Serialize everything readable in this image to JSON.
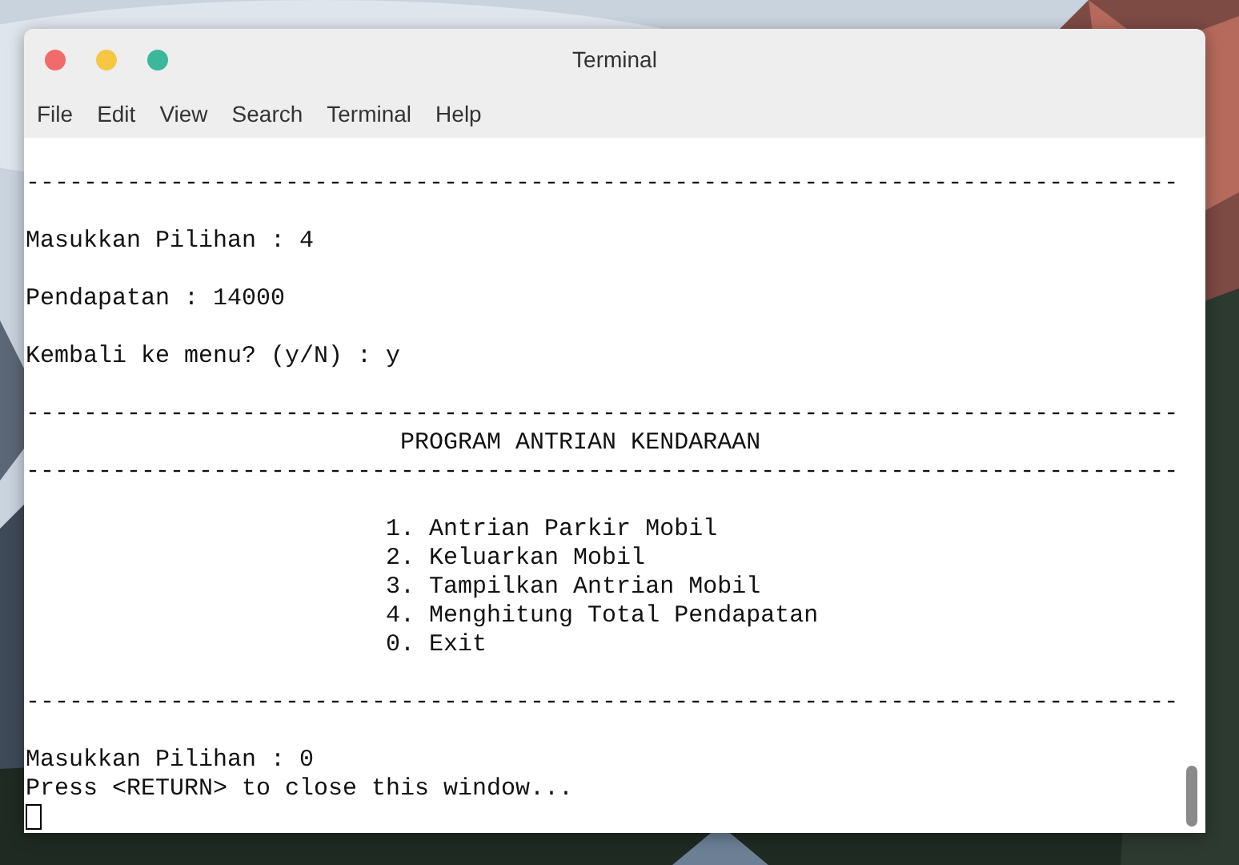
{
  "window": {
    "title": "Terminal",
    "controls": [
      {
        "color": "#f26b6b"
      },
      {
        "color": "#f7c744"
      },
      {
        "color": "#3bb89a"
      }
    ]
  },
  "menu": [
    "File",
    "Edit",
    "View",
    "Search",
    "Terminal",
    "Help"
  ],
  "terminal": {
    "lines": [
      {
        "kind": "blank"
      },
      {
        "kind": "text",
        "text": "--------------------------------------------------------------------------------"
      },
      {
        "kind": "blank"
      },
      {
        "kind": "text",
        "text": "Masukkan Pilihan : 4"
      },
      {
        "kind": "blank"
      },
      {
        "kind": "text",
        "text": "Pendapatan : 14000"
      },
      {
        "kind": "blank"
      },
      {
        "kind": "text",
        "text": "Kembali ke menu? (y/N) : y"
      },
      {
        "kind": "blank"
      },
      {
        "kind": "text",
        "text": "--------------------------------------------------------------------------------"
      },
      {
        "kind": "text",
        "text": "                          PROGRAM ANTRIAN KENDARAAN"
      },
      {
        "kind": "text",
        "text": "--------------------------------------------------------------------------------"
      },
      {
        "kind": "blank"
      },
      {
        "kind": "text",
        "text": "                         1. Antrian Parkir Mobil"
      },
      {
        "kind": "text",
        "text": "                         2. Keluarkan Mobil"
      },
      {
        "kind": "text",
        "text": "                         3. Tampilkan Antrian Mobil"
      },
      {
        "kind": "text",
        "text": "                         4. Menghitung Total Pendapatan"
      },
      {
        "kind": "text",
        "text": "                         0. Exit"
      },
      {
        "kind": "blank"
      },
      {
        "kind": "text",
        "text": "--------------------------------------------------------------------------------"
      },
      {
        "kind": "blank"
      },
      {
        "kind": "text",
        "text": "Masukkan Pilihan : 0"
      },
      {
        "kind": "text",
        "text": "Press <RETURN> to close this window..."
      },
      {
        "kind": "cursor"
      }
    ]
  }
}
